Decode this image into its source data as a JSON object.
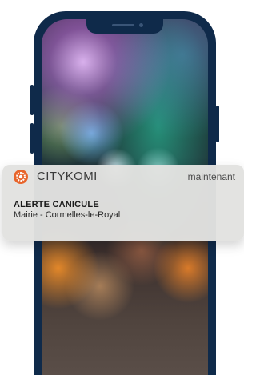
{
  "notification": {
    "app_icon": "citykomi-logo-icon",
    "app_name": "CITYKOMI",
    "timestamp": "maintenant",
    "title": "ALERTE CANICULE",
    "body": "Mairie - Cormelles-le-Royal"
  },
  "colors": {
    "phone_frame": "#0f2a4a",
    "app_icon_bg": "#e8652b",
    "notification_bg": "#e2e2e0"
  }
}
